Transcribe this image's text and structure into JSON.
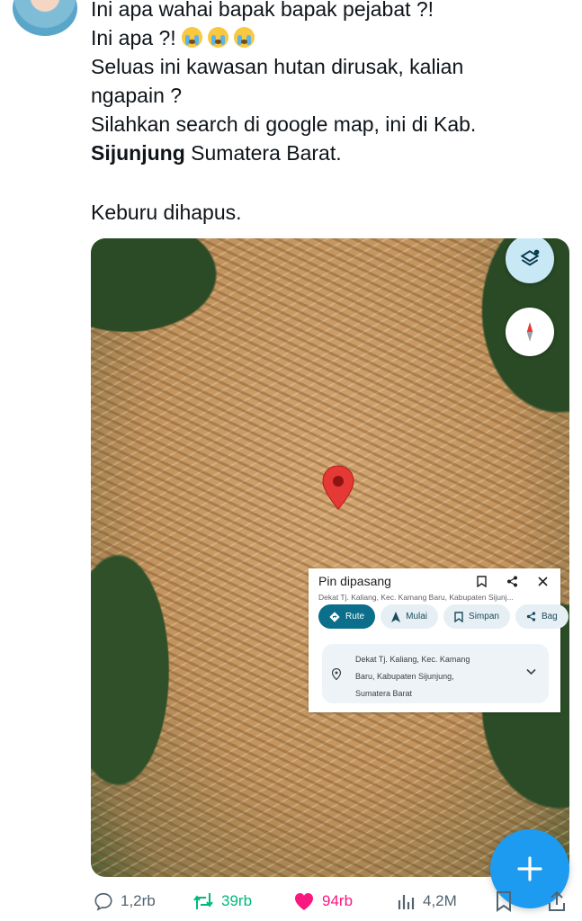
{
  "tweet": {
    "lines": [
      "Ini apa wahai bapak bapak pejabat ?!",
      "Ini apa ?!",
      "Seluas ini kawasan hutan dirusak, kalian",
      "ngapain ?",
      "Silahkan search di google map, ini di Kab.",
      "Sijunjung",
      " Sumatera Barat.",
      "Keburu dihapus."
    ]
  },
  "map": {
    "card": {
      "title": "Pin dipasang",
      "subtitle": "Dekat Tj. Kaliang, Kec. Kamang Baru, Kabupaten Sijunj...",
      "chips": [
        "Rute",
        "Mulai",
        "Simpan",
        "Bag"
      ],
      "address_lines": [
        "Dekat Tj. Kaliang, Kec. Kamang",
        "Baru, Kabupaten Sijunjung,",
        "Sumatera Barat"
      ]
    }
  },
  "actions": {
    "replies": "1,2rb",
    "retweets": "39rb",
    "likes": "94rb",
    "views": "4,2M"
  },
  "colors": {
    "accent": "#1d9bf0",
    "retweet": "#00ba7c",
    "like": "#f91880",
    "muted": "#536471"
  }
}
